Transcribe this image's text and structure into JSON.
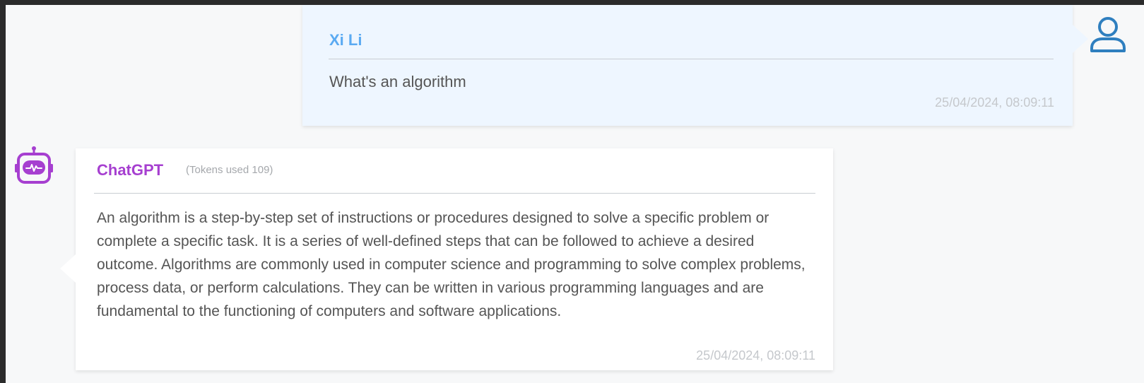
{
  "messages": {
    "user": {
      "name": "Xi Li",
      "text": "What's an algorithm",
      "timestamp": "25/04/2024, 08:09:11",
      "avatar_icon": "user-icon",
      "accent_color": "#5aaaf2"
    },
    "bot": {
      "name": "ChatGPT",
      "tokens": "(Tokens used 109)",
      "text": "An algorithm is a step-by-step set of instructions or procedures designed to solve a specific problem or complete a specific task. It is a series of well-defined steps that can be followed to achieve a desired outcome. Algorithms are commonly used in computer science and programming to solve complex problems, process data, or perform calculations. They can be written in various programming languages and are fundamental to the functioning of computers and software applications.",
      "timestamp": "25/04/2024, 08:09:11",
      "avatar_icon": "robot-icon",
      "accent_color": "#a63fd0"
    }
  }
}
